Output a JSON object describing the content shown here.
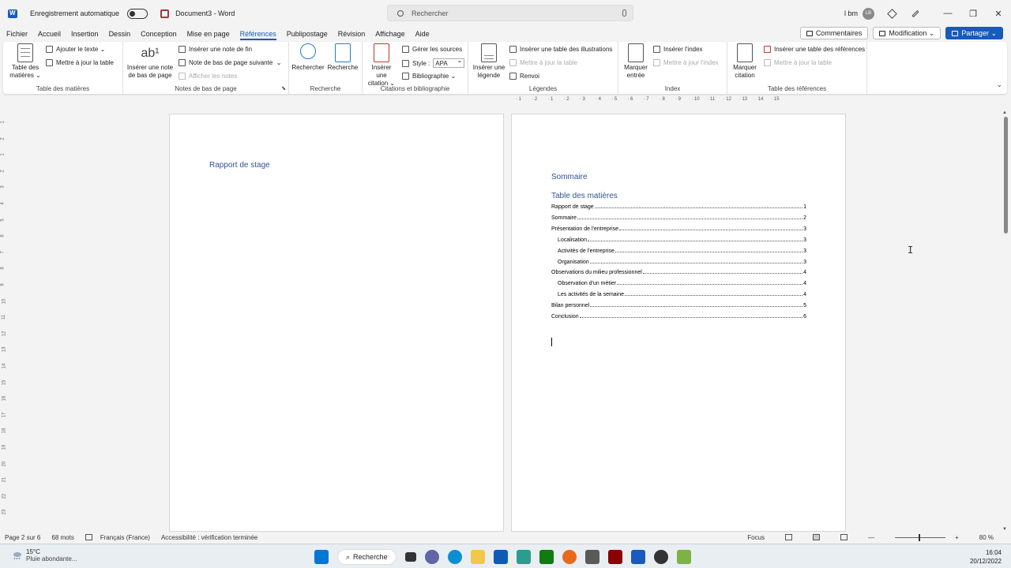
{
  "titlebar": {
    "autosave_label": "Enregistrement automatique",
    "doc_title": "Document3  -  Word",
    "search_placeholder": "Rechercher",
    "username": "l bm",
    "avatar_initials": "LB",
    "minimize": "—",
    "restore": "❐",
    "close": "✕"
  },
  "menu": {
    "items": [
      "Fichier",
      "Accueil",
      "Insertion",
      "Dessin",
      "Conception",
      "Mise en page",
      "Références",
      "Publipostage",
      "Révision",
      "Affichage",
      "Aide"
    ],
    "active": "Références",
    "comments": "Commentaires",
    "modification": "Modification ⌄",
    "share": "Partager"
  },
  "ribbon": {
    "toc": {
      "label": "Table des matières",
      "btn": "Table des matières ⌄",
      "add_text": "Ajouter le texte ⌄",
      "update_table": "Mettre à jour la table"
    },
    "footnotes": {
      "label": "Notes de bas de page",
      "insert_footnote": "Insérer une note de bas de page",
      "insert_endnote": "Insérer une note de fin",
      "next_footnote": "Note de bas de page suivante",
      "show_notes": "Afficher les notes"
    },
    "research": {
      "label": "Recherche",
      "search": "Rechercher",
      "researcher": "Recherche"
    },
    "citations": {
      "label": "Citations et bibliographie",
      "insert_citation": "Insérer une citation ⌄",
      "manage_sources": "Gérer les sources",
      "style_label": "Style :",
      "style_value": "APA",
      "bibliography": "Bibliographie ⌄"
    },
    "captions": {
      "label": "Légendes",
      "insert_caption": "Insérer une légende",
      "insert_table_figures": "Insérer une table des illustrations",
      "update_table": "Mettre à jour la table",
      "cross_ref": "Renvoi"
    },
    "index": {
      "label": "Index",
      "mark_entry": "Marquer entrée",
      "insert_index": "Insérer l'index",
      "update_index": "Mettre à jour l'index"
    },
    "authorities": {
      "label": "Table des références",
      "mark_citation": "Marquer citation",
      "insert_table": "Insérer une table des références",
      "update_table": "Mettre à jour la table"
    }
  },
  "ruler": {
    "h_ticks": [
      "1",
      "2",
      "1",
      "2",
      "3",
      "4",
      "5",
      "6",
      "7",
      "8",
      "9",
      "10",
      "11",
      "12",
      "13",
      "14",
      "15"
    ],
    "v_ticks": [
      "1",
      "2",
      "1",
      "2",
      "3",
      "4",
      "5",
      "6",
      "7",
      "8",
      "9",
      "10",
      "11",
      "12",
      "13",
      "14",
      "15",
      "16",
      "17",
      "18",
      "19",
      "20",
      "21",
      "22",
      "23"
    ]
  },
  "page1": {
    "title": "Rapport de stage"
  },
  "page2": {
    "heading": "Sommaire",
    "toc_title": "Table des matières",
    "toc": [
      {
        "text": "Rapport de stage",
        "page": "1",
        "level": 1
      },
      {
        "text": "Sommaire",
        "page": "2",
        "level": 1
      },
      {
        "text": "Présentation de l'entreprise",
        "page": "3",
        "level": 1
      },
      {
        "text": "Localisation",
        "page": "3",
        "level": 2
      },
      {
        "text": "Activités de l'entreprise",
        "page": "3",
        "level": 2
      },
      {
        "text": "Organisation",
        "page": "3",
        "level": 2
      },
      {
        "text": "Observations du milieu professionnel",
        "page": "4",
        "level": 1
      },
      {
        "text": "Observation d'un métier",
        "page": "4",
        "level": 2
      },
      {
        "text": "Les activités de la semaine",
        "page": "4",
        "level": 2
      },
      {
        "text": "Bilan personnel",
        "page": "5",
        "level": 1
      },
      {
        "text": "Conclusion",
        "page": "6",
        "level": 1
      }
    ]
  },
  "statusbar": {
    "page": "Page 2 sur 6",
    "words": "68 mots",
    "language": "Français (France)",
    "accessibility": "Accessibilité : vérification terminée",
    "focus": "Focus",
    "zoom": "80 %"
  },
  "taskbar": {
    "temp": "15°C",
    "condition": "Pluie abondante...",
    "search": "Recherche",
    "time": "16:04",
    "date": "20/12/2022"
  }
}
